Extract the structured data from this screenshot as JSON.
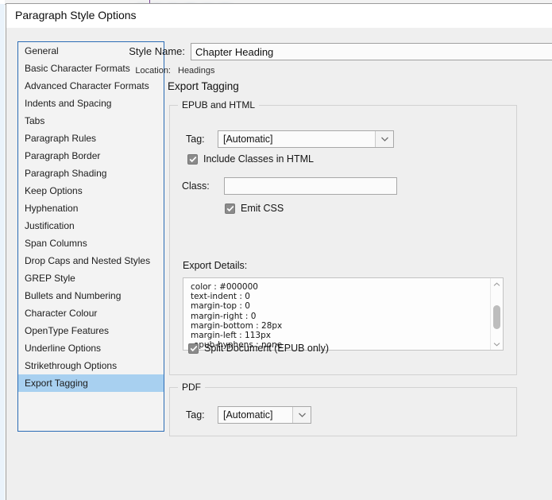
{
  "dialog": {
    "title": "Paragraph Style Options",
    "redacted_title_placeholder": ""
  },
  "categories": {
    "items": [
      {
        "label": "General",
        "selected": false
      },
      {
        "label": "Basic Character Formats",
        "selected": false
      },
      {
        "label": "Advanced Character Formats",
        "selected": false
      },
      {
        "label": "Indents and Spacing",
        "selected": false
      },
      {
        "label": "Tabs",
        "selected": false
      },
      {
        "label": "Paragraph Rules",
        "selected": false
      },
      {
        "label": "Paragraph Border",
        "selected": false
      },
      {
        "label": "Paragraph Shading",
        "selected": false
      },
      {
        "label": "Keep Options",
        "selected": false
      },
      {
        "label": "Hyphenation",
        "selected": false
      },
      {
        "label": "Justification",
        "selected": false
      },
      {
        "label": "Span Columns",
        "selected": false
      },
      {
        "label": "Drop Caps and Nested Styles",
        "selected": false
      },
      {
        "label": "GREP Style",
        "selected": false
      },
      {
        "label": "Bullets and Numbering",
        "selected": false
      },
      {
        "label": "Character Colour",
        "selected": false
      },
      {
        "label": "OpenType Features",
        "selected": false
      },
      {
        "label": "Underline Options",
        "selected": false
      },
      {
        "label": "Strikethrough Options",
        "selected": false
      },
      {
        "label": "Export Tagging",
        "selected": true
      }
    ],
    "selection_color": "#a8d0f0",
    "border_color": "#2b6cb5"
  },
  "header": {
    "style_name_label": "Style Name:",
    "style_name_value": "Chapter Heading",
    "style_name_placeholder": "Style Name",
    "location_label": "Location:",
    "location_value": "Headings"
  },
  "pane": {
    "title": "Export Tagging"
  },
  "epub_group": {
    "legend": "EPUB and HTML",
    "tag_label": "Tag:",
    "tag_value": "[Automatic]",
    "tag_options": [
      "[Automatic]"
    ],
    "include_classes_label": "Include Classes in HTML",
    "include_classes_checked": true,
    "class_label": "Class:",
    "class_value": "",
    "class_placeholder": "",
    "emit_css_label": "Emit CSS",
    "emit_css_checked": true,
    "export_details_label": "Export Details:",
    "export_details_lines": [
      "color : #000000",
      "text-indent : 0",
      "margin-top : 0",
      "margin-right : 0",
      "margin-bottom : 28px",
      "margin-left : 113px",
      "-epub-hyphens : none"
    ],
    "split_document_label": "Split Document (EPUB only)",
    "split_document_checked": true
  },
  "pdf_group": {
    "legend": "PDF",
    "tag_label": "Tag:",
    "tag_value": "[Automatic]",
    "tag_options": [
      "[Automatic]"
    ]
  },
  "icons": {
    "chevron_down": "chevron-down-icon",
    "scroll_up": "scroll-up-arrow-icon",
    "scroll_down": "scroll-down-arrow-icon",
    "checkmark": "checkmark-icon"
  }
}
